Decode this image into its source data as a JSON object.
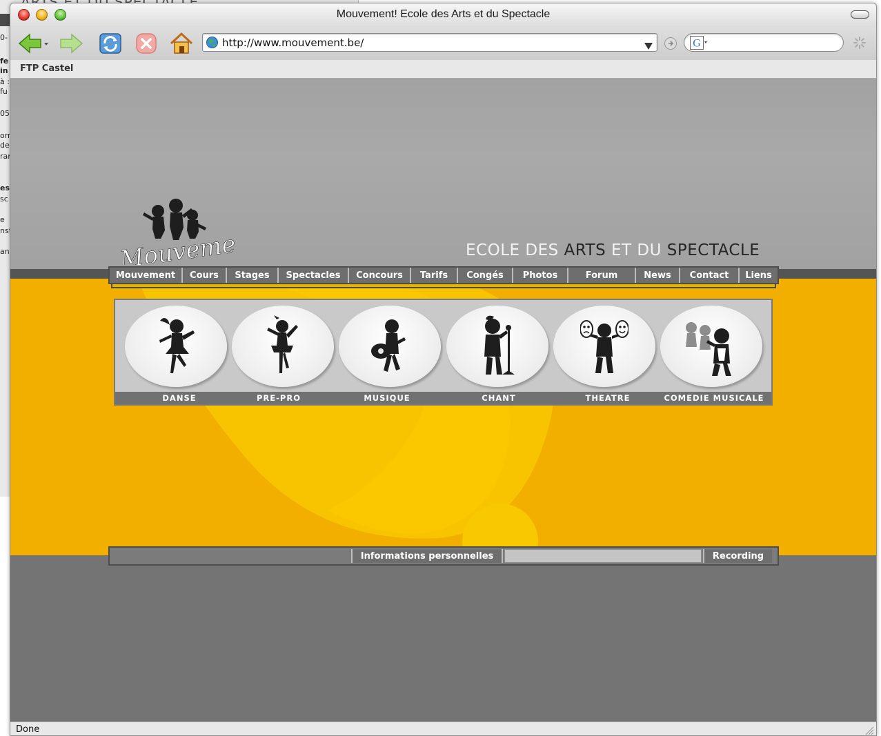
{
  "window": {
    "title": "Mouvement! Ecole des Arts et du Spectacle"
  },
  "toolbar": {
    "back_icon": "back-arrow-icon",
    "forward_icon": "forward-arrow-icon",
    "reload_icon": "reload-icon",
    "stop_icon": "stop-icon",
    "home_icon": "home-icon"
  },
  "address": {
    "url": "http://www.mouvement.be/"
  },
  "search": {
    "engine": "G",
    "value": ""
  },
  "bookmarks": {
    "items": [
      "FTP Castel"
    ]
  },
  "site": {
    "logo_text": "Mouvement!",
    "tagline": {
      "part1": "ECOLE DES ",
      "part2": "ARTS",
      "part3": " ET DU ",
      "part4": "SPECTACLE"
    },
    "nav": [
      "Mouvement",
      "Cours",
      "Stages",
      "Spectacles",
      "Concours",
      "Tarifs",
      "Congés",
      "Photos",
      "Forum",
      "News",
      "Contact",
      "Liens"
    ],
    "categories": [
      "DANSE",
      "PRE-PRO",
      "MUSIQUE",
      "CHANT",
      "THEATRE",
      "COMEDIE MUSICALE"
    ],
    "bottom": {
      "info_label": "Informations personnelles",
      "recording_label": "Recording"
    },
    "colors": {
      "accent_yellow": "#f2af00",
      "nav_gray": "#6e6e6e",
      "page_gray": "#a2a2a2"
    }
  },
  "status": {
    "text": "Done"
  }
}
